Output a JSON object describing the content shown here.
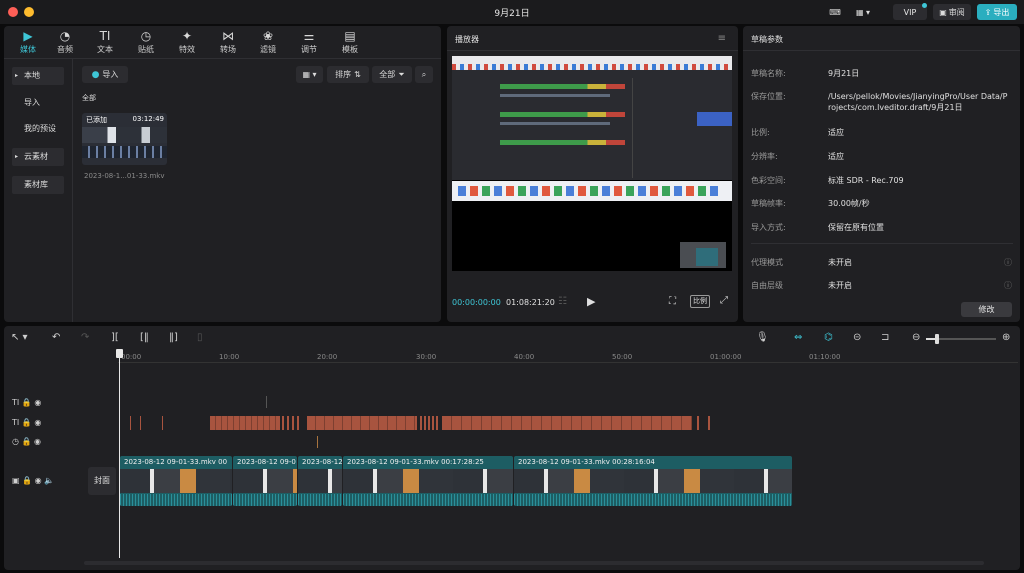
{
  "window": {
    "title": "9月21日"
  },
  "titlebar": {
    "vip_label": "VIP",
    "review_label": "审阅",
    "export_label": "导出"
  },
  "media": {
    "tabs": [
      {
        "label": "媒体",
        "icon": "media-icon"
      },
      {
        "label": "音频",
        "icon": "audio-icon"
      },
      {
        "label": "文本",
        "icon": "text-icon"
      },
      {
        "label": "贴纸",
        "icon": "sticker-icon"
      },
      {
        "label": "特效",
        "icon": "effects-icon"
      },
      {
        "label": "转场",
        "icon": "transition-icon"
      },
      {
        "label": "滤镜",
        "icon": "filter-icon"
      },
      {
        "label": "调节",
        "icon": "adjust-icon"
      },
      {
        "label": "模板",
        "icon": "template-icon"
      }
    ],
    "sidebar": {
      "local": "本地",
      "import": "导入",
      "my_presets": "我的预设",
      "cloud": "云素材",
      "library": "素材库"
    },
    "import_button": "导入",
    "sort_label": "排序",
    "filter_label": "全部",
    "section_label": "全部",
    "item": {
      "badge": "已添加",
      "duration": "03:12:49",
      "filename": "2023-08-1...01-33.mkv"
    }
  },
  "player": {
    "title": "播放器",
    "current_time": "00:00:00:00",
    "total_time": "01:08:21:20",
    "ratio_label": "比例"
  },
  "params": {
    "title": "草稿参数",
    "rows": [
      {
        "label": "草稿名称:",
        "value": "9月21日"
      },
      {
        "label": "保存位置:",
        "value": "/Users/pellok/Movies/JianyingPro/User Data/Projects/com.lveditor.draft/9月21日"
      },
      {
        "label": "比例:",
        "value": "适应"
      },
      {
        "label": "分辨率:",
        "value": "适应"
      },
      {
        "label": "色彩空间:",
        "value": "标准 SDR - Rec.709"
      },
      {
        "label": "草稿帧率:",
        "value": "30.00帧/秒"
      },
      {
        "label": "导入方式:",
        "value": "保留在原有位置"
      }
    ],
    "proxy_label": "代理模式",
    "proxy_value": "未开启",
    "layer_label": "自由层级",
    "layer_value": "未开启",
    "modify_button": "修改"
  },
  "timeline": {
    "ruler": [
      "00:00",
      "10:00",
      "20:00",
      "30:00",
      "40:00",
      "50:00",
      "01:00:00",
      "01:10:00"
    ],
    "cover_label": "封面",
    "clips": [
      {
        "title": "2023-08-12 09-01-33.mkv  00"
      },
      {
        "title": "2023-08-12 09-0"
      },
      {
        "title": "2023-08-12"
      },
      {
        "title": "2023-08-12 09-01-33.mkv   00:17:28:25"
      },
      {
        "title": "2023-08-12 09-01-33.mkv   00:28:16:04"
      }
    ]
  },
  "colors": {
    "accent": "#3ec6d6",
    "audio_track": "#a8543f",
    "clip": "#1d5d63"
  }
}
